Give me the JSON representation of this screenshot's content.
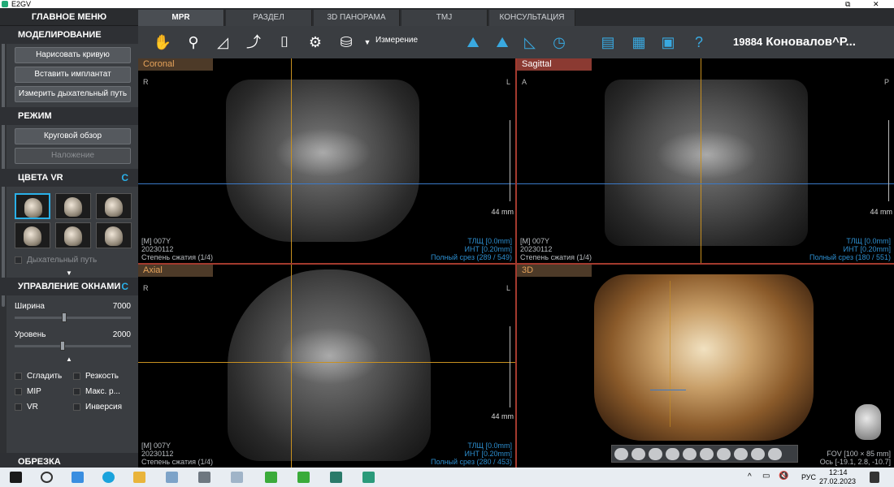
{
  "window": {
    "title": "E2GV",
    "restore_glyph": "⧉",
    "close_glyph": "✕"
  },
  "sidebar": {
    "main_menu": "ГЛАВНОЕ МЕНЮ",
    "modeling": {
      "title": "МОДЕЛИРОВАНИЕ",
      "buttons": [
        "Нарисовать кривую",
        "Вставить имплантат",
        "Измерить дыхательный путь"
      ]
    },
    "mode": {
      "title": "РЕЖИМ",
      "buttons": [
        "Круговой обзор",
        "Наложение"
      ]
    },
    "vr_colors": {
      "title": "ЦВЕТА VR",
      "airway_label": "Дыхательный путь",
      "refresh_glyph": "C"
    },
    "window_control": {
      "title": "УПРАВЛЕНИЕ ОКНАМИ",
      "refresh_glyph": "C",
      "width_label": "Ширина",
      "width_value": "7000",
      "level_label": "Уровень",
      "level_value": "2000",
      "options": [
        "Сгладить",
        "Резкость",
        "MIP",
        "Макс. р...",
        "VR",
        "Инверсия"
      ]
    },
    "crop": {
      "title": "ОБРЕЗКА"
    }
  },
  "tabs": [
    "MPR",
    "РАЗДЕЛ",
    "3D ПАНОРАМА",
    "TMJ",
    "КОНСУЛЬТАЦИЯ"
  ],
  "active_tab": "MPR",
  "toolbar": {
    "measure_label": "Измерение",
    "patient_id": "19884",
    "patient_name": "Коновалов^Р..."
  },
  "viewports": {
    "coronal": {
      "label": "Coronal",
      "left": "R",
      "right": "L",
      "scale": "44 mm",
      "info_left": [
        "[M] 007Y",
        "20230112",
        "Степень сжатия (1/4)"
      ],
      "info_right": [
        "ТЛЩ [0.0mm]",
        "ИНТ [0.20mm]",
        "Полный срез (289 / 549)"
      ]
    },
    "sagittal": {
      "label": "Sagittal",
      "left": "A",
      "right": "P",
      "scale": "44 mm",
      "info_left": [
        "[M] 007Y",
        "20230112",
        "Степень сжатия (1/4)"
      ],
      "info_right": [
        "ТЛЩ [0.0mm]",
        "ИНТ [0.20mm]",
        "Полный срез (180 / 551)"
      ]
    },
    "axial": {
      "label": "Axial",
      "left": "R",
      "right": "L",
      "scale": "44 mm",
      "info_left": [
        "[M] 007Y",
        "20230112",
        "Степень сжатия (1/4)"
      ],
      "info_right": [
        "ТЛЩ [0.0mm]",
        "ИНТ [0.20mm]",
        "Полный срез (280 / 453)"
      ]
    },
    "threed": {
      "label": "3D",
      "fov": [
        "FOV [100 × 85 mm]",
        "Ось [-19.1, 2.8, -10.7]"
      ]
    }
  },
  "taskbar": {
    "language": "РУС",
    "time": "12:14",
    "date": "27.02.2023",
    "tray_up_glyph": "^",
    "speaker_glyph": "🔇",
    "network_glyph": "▭"
  },
  "colors": {
    "accent_blue": "#2ab0e8",
    "active_viewport": "#a33a2e",
    "crosshair_orange": "#c89020",
    "crosshair_blue": "#3a79c8"
  }
}
